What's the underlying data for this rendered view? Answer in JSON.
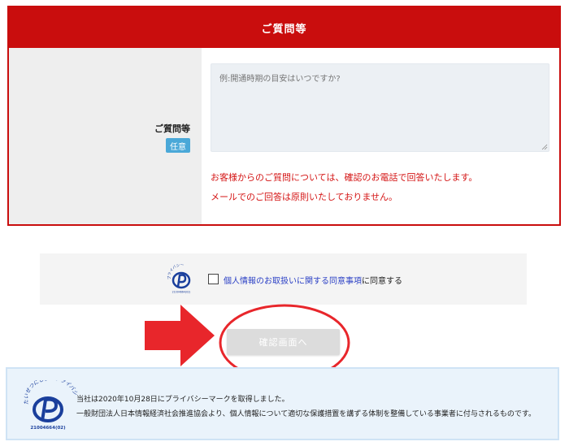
{
  "form": {
    "header_title": "ご質問等",
    "field_label": "ご質問等",
    "optional_badge": "任意",
    "textarea_placeholder": "例:開通時期の目安はいつですか?",
    "notice_line1": "お客様からのご質問については、確認のお電話で回答いたします。",
    "notice_line2": "メールでのご回答は原則いたしておりません。"
  },
  "consent": {
    "link_text": "個人情報のお取扱いに関する同意事項",
    "suffix_text": "に同意する",
    "checked": false,
    "pmark_arc_text": "プライバシー",
    "pmark_number": "21004664(02)"
  },
  "confirm_button": {
    "label": "確認画面へ"
  },
  "privacy": {
    "line1": "当社は2020年10月28日にプライバシーマークを取得しました。",
    "line2": "一般財団法人日本情報経済社会推進協会より、個人情報について適切な保護措置を講ずる体制を整備している事業者に付与されるものです。",
    "pmark_arc_text": "たいせつにしますプライバシー",
    "pmark_number": "21004664(02)"
  },
  "colors": {
    "primary_red": "#c90d0d",
    "notice_red": "#d41414",
    "badge_blue": "#4aa8d8",
    "link_blue": "#2a3fc5",
    "pmark_blue": "#1a3f9c",
    "annotation_red": "#e8262b"
  }
}
